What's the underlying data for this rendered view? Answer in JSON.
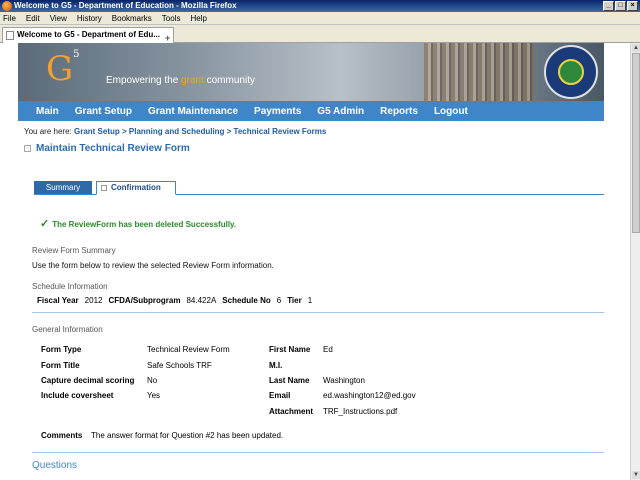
{
  "window": {
    "title": "Welcome to G5 - Department of Education - Mozilla Firefox"
  },
  "menu": [
    "File",
    "Edit",
    "View",
    "History",
    "Bookmarks",
    "Tools",
    "Help"
  ],
  "browser_tab": {
    "label": "Welcome to G5 - Department of Edu..."
  },
  "banner": {
    "logo": "G",
    "logo_sup": "5",
    "tagline_pre": "Empowering the ",
    "tagline_em": "grant",
    "tagline_post": " community"
  },
  "nav": [
    "Main",
    "Grant Setup",
    "Grant Maintenance",
    "Payments",
    "G5 Admin",
    "Reports",
    "Logout"
  ],
  "breadcrumb": {
    "prefix": "You are here:",
    "path": "Grant Setup > Planning and Scheduling > Technical Review Forms"
  },
  "page_title": "Maintain Technical Review Form",
  "tabs": {
    "summary": "Summary",
    "confirmation": "Confirmation"
  },
  "success_message": "The ReviewForm has been deleted Successfully.",
  "review_summary": {
    "heading": "Review Form Summary",
    "text": "Use the form below to review the selected Review Form information."
  },
  "schedule": {
    "heading": "Schedule Information",
    "fiscal_year_label": "Fiscal Year",
    "fiscal_year": "2012",
    "cfda_label": "CFDA/Subprogram",
    "cfda": "84.422A",
    "schedule_no_label": "Schedule No",
    "schedule_no": "6",
    "tier_label": "Tier",
    "tier": "1"
  },
  "general": {
    "heading": "General Information",
    "form_type_label": "Form Type",
    "form_type": "Technical Review Form",
    "form_title_label": "Form Title",
    "form_title": "Safe Schools TRF",
    "decimal_label": "Capture decimal scoring",
    "decimal": "No",
    "coversheet_label": "Include coversheet",
    "coversheet": "Yes",
    "first_name_label": "First Name",
    "first_name": "Ed",
    "mi_label": "M.I.",
    "last_name_label": "Last Name",
    "last_name": "Washington",
    "email_label": "Email",
    "email": "ed.washington12@ed.gov",
    "attachment_label": "Attachment",
    "attachment": "TRF_Instructions.pdf",
    "comments_label": "Comments",
    "comments": "The answer format for Question #2 has been updated."
  },
  "questions_heading": "Questions"
}
